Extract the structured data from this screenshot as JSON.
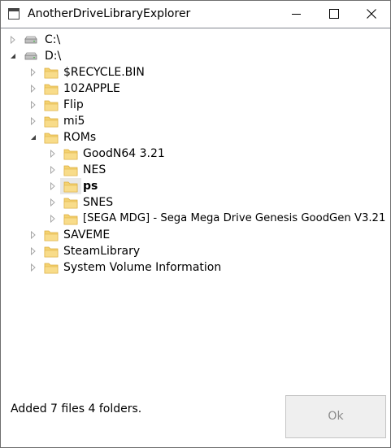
{
  "window": {
    "title": "AnotherDriveLibraryExplorer"
  },
  "tree": {
    "drives": [
      {
        "label": "C:\\",
        "expanded": false
      },
      {
        "label": "D:\\",
        "expanded": true
      }
    ],
    "d_children": [
      {
        "label": "$RECYCLE.BIN",
        "expanded": false
      },
      {
        "label": "102APPLE",
        "expanded": false
      },
      {
        "label": "Flip",
        "expanded": false
      },
      {
        "label": "mi5",
        "expanded": false
      },
      {
        "label": "ROMs",
        "expanded": true
      },
      {
        "label": "SAVEME",
        "expanded": false
      },
      {
        "label": "SteamLibrary",
        "expanded": false
      },
      {
        "label": "System Volume Information",
        "expanded": false
      }
    ],
    "roms_children": [
      {
        "label": "GoodN64 3.21",
        "expanded": false
      },
      {
        "label": "NES",
        "expanded": false
      },
      {
        "label": "ps",
        "expanded": false,
        "selected": true
      },
      {
        "label": "SNES",
        "expanded": false
      },
      {
        "label": "[SEGA MDG] - Sega Mega Drive Genesis GoodGen V3.21",
        "expanded": false
      }
    ]
  },
  "footer": {
    "status": "Added 7 files 4 folders.",
    "ok_label": "Ok"
  },
  "icons": {
    "folder": "folder-icon",
    "drive": "drive-icon",
    "collapsed": "expander-collapsed-icon",
    "expanded": "expander-expanded-icon"
  },
  "colors": {
    "folder_fill": "#f4d271",
    "folder_dark": "#dcae3f",
    "selection": "#e8e8e8",
    "button_disabled_text": "#8a8a8a"
  }
}
